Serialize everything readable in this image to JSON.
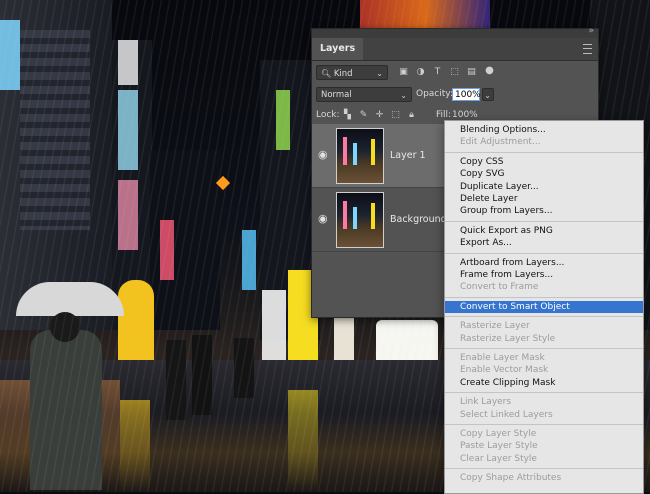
{
  "layers_panel": {
    "tab_title": "Layers",
    "filter": {
      "kind_value": "Kind"
    },
    "blend_mode": "Normal",
    "opacity": {
      "label": "Opacity:",
      "value": "100%"
    },
    "lock": {
      "label": "Lock:"
    },
    "fill": {
      "label": "Fill:",
      "value": "100%"
    },
    "layers": [
      {
        "name": "Layer 1",
        "selected": true
      },
      {
        "name": "Background",
        "selected": false
      }
    ]
  },
  "context_menu": {
    "groups": [
      [
        {
          "label": "Blending Options...",
          "enabled": true
        },
        {
          "label": "Edit Adjustment...",
          "enabled": false
        }
      ],
      [
        {
          "label": "Copy CSS",
          "enabled": true
        },
        {
          "label": "Copy SVG",
          "enabled": true
        },
        {
          "label": "Duplicate Layer...",
          "enabled": true
        },
        {
          "label": "Delete Layer",
          "enabled": true
        },
        {
          "label": "Group from Layers...",
          "enabled": true
        }
      ],
      [
        {
          "label": "Quick Export as PNG",
          "enabled": true
        },
        {
          "label": "Export As...",
          "enabled": true
        }
      ],
      [
        {
          "label": "Artboard from Layers...",
          "enabled": true
        },
        {
          "label": "Frame from Layers...",
          "enabled": true
        },
        {
          "label": "Convert to Frame",
          "enabled": false
        }
      ],
      [
        {
          "label": "Convert to Smart Object",
          "enabled": true,
          "highlighted": true
        }
      ],
      [
        {
          "label": "Rasterize Layer",
          "enabled": false
        },
        {
          "label": "Rasterize Layer Style",
          "enabled": false
        }
      ],
      [
        {
          "label": "Enable Layer Mask",
          "enabled": false
        },
        {
          "label": "Enable Vector Mask",
          "enabled": false
        },
        {
          "label": "Create Clipping Mask",
          "enabled": true
        }
      ],
      [
        {
          "label": "Link Layers",
          "enabled": false
        },
        {
          "label": "Select Linked Layers",
          "enabled": false
        }
      ],
      [
        {
          "label": "Copy Layer Style",
          "enabled": false
        },
        {
          "label": "Paste Layer Style",
          "enabled": false
        },
        {
          "label": "Clear Layer Style",
          "enabled": false
        }
      ],
      [
        {
          "label": "Copy Shape Attributes",
          "enabled": false
        }
      ]
    ]
  },
  "colors": {
    "highlight": "#3574cf",
    "panel_bg": "#535353",
    "menu_bg": "#e6e6e6"
  }
}
